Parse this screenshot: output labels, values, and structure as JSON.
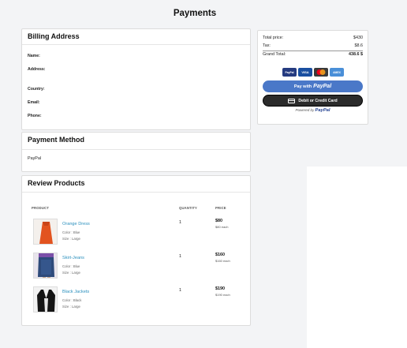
{
  "page": {
    "title": "Payments"
  },
  "billing": {
    "heading": "Billing Address",
    "fields": [
      "Name:",
      "Address:",
      "Country:",
      "Email:",
      "Phone:"
    ]
  },
  "payment_method": {
    "heading": "Payment Method",
    "value": "PayPal"
  },
  "review": {
    "heading": "Review Products",
    "columns": {
      "product": "PRODUCT",
      "quantity": "QUANTITY",
      "price": "PRICE"
    },
    "products": [
      {
        "name": "Orange Dress",
        "color": "Color : Blue",
        "size": "Size : Large",
        "quantity": "1",
        "price": "$80",
        "each": "$80 each",
        "image": "orange-dress-image"
      },
      {
        "name": "Skirt-Jeans",
        "color": "Color : Blue",
        "size": "Size : Large",
        "quantity": "1",
        "price": "$160",
        "each": "$160 each",
        "image": "denim-skirt-image"
      },
      {
        "name": "Black Jackets",
        "color": "Color : Black",
        "size": "Size : Large",
        "quantity": "1",
        "price": "$190",
        "each": "$190 each",
        "image": "black-jacket-image"
      }
    ]
  },
  "summary": {
    "total_price_label": "Total price:",
    "total_price": "$430",
    "tax_label": "Tax:",
    "tax": "$8.6",
    "grand_total_label": "Grand Total:",
    "grand_total": "438.6 $",
    "card_icons": [
      "PayPal",
      "VISA",
      "mastercard-icon",
      "AMEX"
    ],
    "paypal_button": {
      "prefix": "Pay with",
      "brand": "PayPal"
    },
    "card_button": "Debit or Credit Card",
    "powered_by": {
      "prefix": "Powered by",
      "brand": "PayPal"
    }
  },
  "colors": {
    "link": "#2a8fbd",
    "paypal_blue": "#4a78c8",
    "card_button": "#2b2b2b"
  }
}
